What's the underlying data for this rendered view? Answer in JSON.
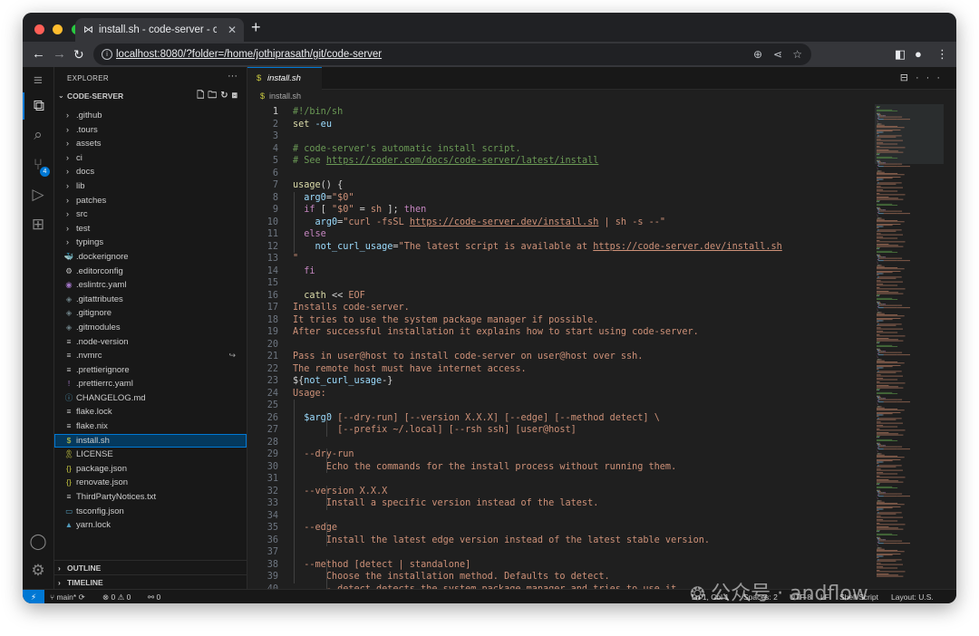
{
  "browser": {
    "tab_title": "install.sh - code-server - code-server",
    "tab_icon": "vscode-icon",
    "url": "localhost:8080/?folder=/home/jothiprasath/git/code-server",
    "traffic_colors": [
      "#ff5f57",
      "#febc2e",
      "#28c840"
    ]
  },
  "explorer": {
    "title": "EXPLORER",
    "root": "CODE-SERVER",
    "items": [
      {
        "label": ".github",
        "type": "folder"
      },
      {
        "label": ".tours",
        "type": "folder"
      },
      {
        "label": "assets",
        "type": "folder"
      },
      {
        "label": "ci",
        "type": "folder"
      },
      {
        "label": "docs",
        "type": "folder"
      },
      {
        "label": "lib",
        "type": "folder"
      },
      {
        "label": "patches",
        "type": "folder"
      },
      {
        "label": "src",
        "type": "folder"
      },
      {
        "label": "test",
        "type": "folder"
      },
      {
        "label": "typings",
        "type": "folder"
      },
      {
        "label": ".dockerignore",
        "type": "docker",
        "icon": "🐳",
        "color": "#4a90d9"
      },
      {
        "label": ".editorconfig",
        "type": "config",
        "icon": "⚙",
        "color": "#c5c5c5"
      },
      {
        "label": ".eslintrc.yaml",
        "type": "eslint",
        "icon": "◉",
        "color": "#a074c4"
      },
      {
        "label": ".gitattributes",
        "type": "git",
        "icon": "◈",
        "color": "#6d8086"
      },
      {
        "label": ".gitignore",
        "type": "git",
        "icon": "◈",
        "color": "#6d8086"
      },
      {
        "label": ".gitmodules",
        "type": "git",
        "icon": "◈",
        "color": "#6d8086"
      },
      {
        "label": ".node-version",
        "type": "text",
        "icon": "≡",
        "color": "#c5c5c5"
      },
      {
        "label": ".nvmrc",
        "type": "text",
        "icon": "≡",
        "color": "#c5c5c5"
      },
      {
        "label": ".prettierignore",
        "type": "text",
        "icon": "≡",
        "color": "#c5c5c5"
      },
      {
        "label": ".prettierrc.yaml",
        "type": "yaml",
        "icon": "!",
        "color": "#a074c4"
      },
      {
        "label": "CHANGELOG.md",
        "type": "md",
        "icon": "ⓘ",
        "color": "#519aba"
      },
      {
        "label": "flake.lock",
        "type": "text",
        "icon": "≡",
        "color": "#c5c5c5"
      },
      {
        "label": "flake.nix",
        "type": "text",
        "icon": "≡",
        "color": "#c5c5c5"
      },
      {
        "label": "install.sh",
        "type": "shell",
        "icon": "$",
        "color": "#cbcb41"
      },
      {
        "label": "LICENSE",
        "type": "license",
        "icon": "🎗",
        "color": "#cbcb41"
      },
      {
        "label": "package.json",
        "type": "json",
        "icon": "{}",
        "color": "#cbcb41"
      },
      {
        "label": "renovate.json",
        "type": "json",
        "icon": "{}",
        "color": "#cbcb41"
      },
      {
        "label": "ThirdPartyNotices.txt",
        "type": "text",
        "icon": "≡",
        "color": "#c5c5c5"
      },
      {
        "label": "tsconfig.json",
        "type": "tsconfig",
        "icon": "▭",
        "color": "#519aba"
      },
      {
        "label": "yarn.lock",
        "type": "yarn",
        "icon": "▲",
        "color": "#519aba"
      }
    ],
    "selected_index": 23,
    "nvmrc_decoration": "↪",
    "outline_label": "OUTLINE",
    "timeline_label": "TIMELINE"
  },
  "editor": {
    "tab_label": "install.sh",
    "breadcrumb": "install.sh",
    "lines": [
      [
        [
          "c",
          "#!/bin/sh"
        ]
      ],
      [
        [
          "f",
          "set"
        ],
        [
          "o",
          " "
        ],
        [
          "v",
          "-eu"
        ]
      ],
      [],
      [
        [
          "c",
          "# code-server's automatic install script."
        ]
      ],
      [
        [
          "c",
          "# See "
        ],
        [
          "cu",
          "https://coder.com/docs/code-server/latest/install"
        ]
      ],
      [],
      [
        [
          "f",
          "usage"
        ],
        [
          "o",
          "() {"
        ]
      ],
      [
        [
          "o",
          "  "
        ],
        [
          "v",
          "arg0"
        ],
        [
          "o",
          "="
        ],
        [
          "s",
          "\"$0\""
        ]
      ],
      [
        [
          "o",
          "  "
        ],
        [
          "k",
          "if"
        ],
        [
          "o",
          " [ "
        ],
        [
          "s",
          "\"$0\""
        ],
        [
          "o",
          " = "
        ],
        [
          "s",
          "sh"
        ],
        [
          "o",
          " ]; "
        ],
        [
          "k",
          "then"
        ]
      ],
      [
        [
          "o",
          "    "
        ],
        [
          "v",
          "arg0"
        ],
        [
          "o",
          "="
        ],
        [
          "s",
          "\"curl -fsSL "
        ],
        [
          "su",
          "https://code-server.dev/install.sh"
        ],
        [
          "s",
          " | sh -s --\""
        ]
      ],
      [
        [
          "o",
          "  "
        ],
        [
          "k",
          "else"
        ]
      ],
      [
        [
          "o",
          "    "
        ],
        [
          "v",
          "not_curl_usage"
        ],
        [
          "o",
          "="
        ],
        [
          "s",
          "\"The latest script is available at "
        ],
        [
          "su",
          "https://code-server.dev/install.sh"
        ]
      ],
      [
        [
          "s",
          "\""
        ]
      ],
      [
        [
          "o",
          "  "
        ],
        [
          "k",
          "fi"
        ]
      ],
      [],
      [
        [
          "o",
          "  "
        ],
        [
          "f",
          "cath"
        ],
        [
          "o",
          " << "
        ],
        [
          "s",
          "EOF"
        ]
      ],
      [
        [
          "s",
          "Installs code-server."
        ]
      ],
      [
        [
          "s",
          "It tries to use the system package manager if possible."
        ]
      ],
      [
        [
          "s",
          "After successful installation it explains how to start using code-server."
        ]
      ],
      [],
      [
        [
          "s",
          "Pass in user@host to install code-server on user@host over ssh."
        ]
      ],
      [
        [
          "s",
          "The remote host must have internet access."
        ]
      ],
      [
        [
          "o",
          "${"
        ],
        [
          "v",
          "not_curl_usage"
        ],
        [
          "o",
          "-}"
        ]
      ],
      [
        [
          "s",
          "Usage:"
        ]
      ],
      [],
      [
        [
          "s",
          "  "
        ],
        [
          "v",
          "$arg0"
        ],
        [
          "s",
          " [--dry-run] [--version X.X.X] [--edge] [--method detect] \\"
        ]
      ],
      [
        [
          "s",
          "        [--prefix ~/.local] [--rsh ssh] [user@host]"
        ]
      ],
      [],
      [
        [
          "s",
          "  --dry-run"
        ]
      ],
      [
        [
          "s",
          "      Echo the commands for the install process without running them."
        ]
      ],
      [],
      [
        [
          "s",
          "  --version X.X.X"
        ]
      ],
      [
        [
          "s",
          "      Install a specific version instead of the latest."
        ]
      ],
      [],
      [
        [
          "s",
          "  --edge"
        ]
      ],
      [
        [
          "s",
          "      Install the latest edge version instead of the latest stable version."
        ]
      ],
      [],
      [
        [
          "s",
          "  --method [detect | standalone]"
        ]
      ],
      [
        [
          "s",
          "      Choose the installation method. Defaults to detect."
        ]
      ],
      [
        [
          "s",
          "      - detect detects the system package manager and tries to use it."
        ]
      ]
    ],
    "current_line": 1
  },
  "status": {
    "branch": "main*",
    "errors": "0",
    "warnings": "0",
    "ports": "0",
    "cursor": "Ln 1, Col 1",
    "spaces": "Spaces: 2",
    "encoding": "UTF-8",
    "eol": "LF",
    "language": "Shell Script",
    "layout": "Layout: U.S."
  },
  "watermark": "公众号 · andflow"
}
